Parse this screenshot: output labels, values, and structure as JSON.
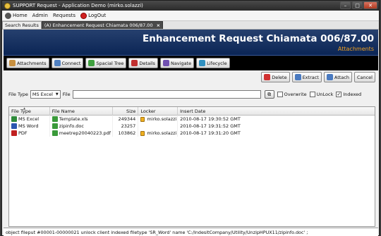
{
  "window": {
    "title": "SUPPORT Request - Application Demo (mirko.solazzi)",
    "controls": [
      "minimize-icon",
      "maximize-icon",
      "close-icon"
    ]
  },
  "menu": [
    {
      "label": "Home",
      "icon": "home-icon",
      "color": "#444444"
    },
    {
      "label": "Admin"
    },
    {
      "label": "Requests"
    },
    {
      "label": "LogOut",
      "icon": "power-icon",
      "color": "#d02020"
    }
  ],
  "tabs": [
    {
      "label": "Search Results"
    },
    {
      "label": "(A) Enhancement Request Chiamata 006/87.00",
      "close": "×"
    }
  ],
  "header": {
    "title": "Enhancement Request Chiamata 006/87.00",
    "subtitle": "Attachments",
    "bg": "#0b2555",
    "accent": "#f0a020"
  },
  "nav": [
    {
      "label": "Attachments",
      "icon": "attachment-icon"
    },
    {
      "label": "Connect",
      "icon": "connect-icon"
    },
    {
      "label": "Spacial Tree",
      "icon": "tree-icon"
    },
    {
      "label": "Details",
      "icon": "details-icon"
    },
    {
      "label": "Navigate",
      "icon": "navigate-icon"
    },
    {
      "label": "Lifecycle",
      "icon": "lifecycle-icon"
    }
  ],
  "actions": [
    {
      "label": "Delete",
      "icon": "delete-icon"
    },
    {
      "label": "Extract",
      "icon": "extract-icon"
    },
    {
      "label": "Attach",
      "icon": "attach-icon"
    },
    {
      "label": "Cancel"
    }
  ],
  "filebar": {
    "file_type_label": "File Type",
    "file_type_value": "MS Excel",
    "file_label": "File",
    "file_value": "",
    "overwrite": {
      "label": "Overwrite",
      "checked": false
    },
    "unlock": {
      "label": "UnLock",
      "checked": false
    },
    "indexed": {
      "label": "Indexed",
      "checked": true,
      "mark": "✓"
    }
  },
  "table": {
    "columns": [
      "File Type",
      "File Name",
      "Size",
      "Locker",
      "Insert Date"
    ],
    "rows": [
      {
        "type": "MS Excel",
        "type_icon": "excel-icon",
        "name": "Template.xls",
        "size": "249344",
        "locker": "mirko.solazzi",
        "date": "2010-08-17 19:30:52 GMT"
      },
      {
        "type": "MS Word",
        "type_icon": "word-icon",
        "name": "zipinfo.doc",
        "size": "23257",
        "locker": "",
        "date": "2010-08-17 19:31:52 GMT"
      },
      {
        "type": "PDF",
        "type_icon": "pdf-icon",
        "name": "meetrep20040223.pdf",
        "size": "103862",
        "locker": "mirko.solazzi",
        "date": "2010-08-17 19:31:20 GMT"
      }
    ]
  },
  "status": {
    "text": "object fileput #00001-00000021 unlock client indexed  filetype 'SR_Word' name 'C:/IndesitCompany/Utility/UnzipHPUX11/zipinfo.doc' ;"
  }
}
